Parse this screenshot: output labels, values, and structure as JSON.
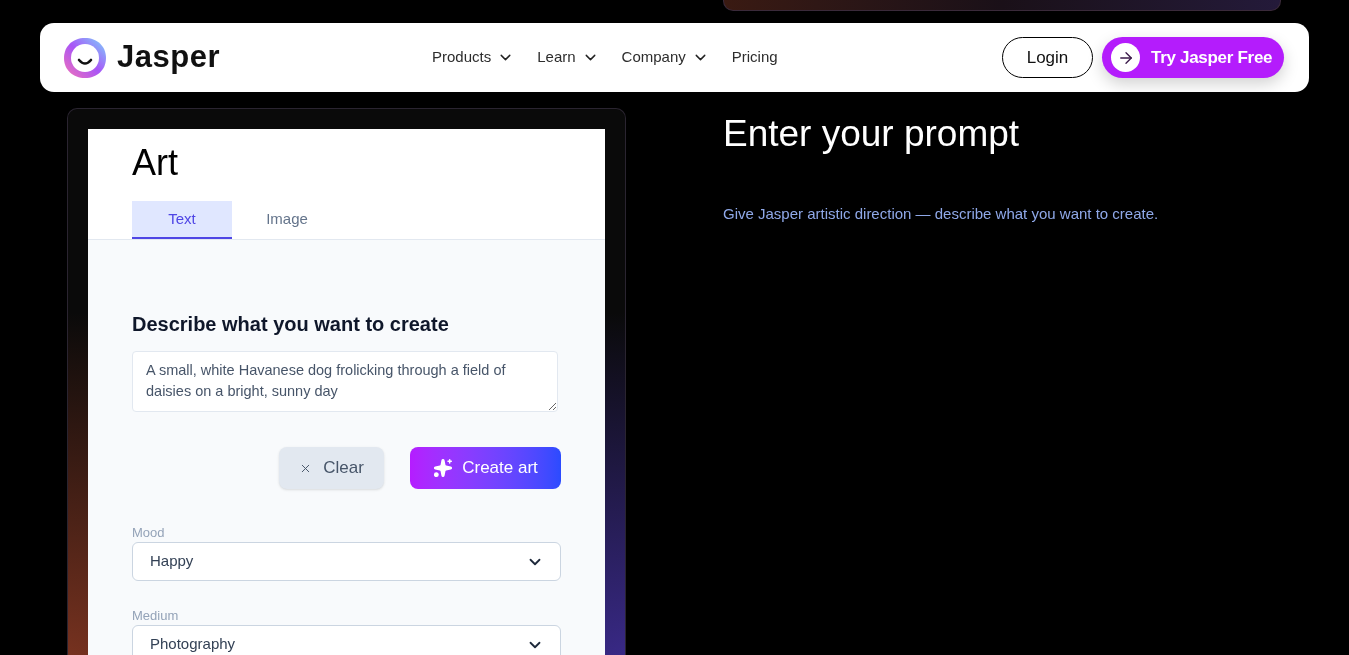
{
  "nav": {
    "brand": "Jasper",
    "links": [
      {
        "label": "Products",
        "dropdown": true
      },
      {
        "label": "Learn",
        "dropdown": true
      },
      {
        "label": "Company",
        "dropdown": true
      },
      {
        "label": "Pricing",
        "dropdown": false
      }
    ],
    "login": "Login",
    "cta": "Try Jasper Free"
  },
  "demo": {
    "title": "Art",
    "tabs": [
      {
        "label": "Text",
        "selected": true
      },
      {
        "label": "Image",
        "selected": false
      }
    ],
    "heading": "Describe what you want to create",
    "prompt": "A small, white Havanese dog frolicking through a field of daisies on a bright, sunny day",
    "clear": "Clear",
    "create": "Create art",
    "selects": [
      {
        "label": "Mood",
        "value": "Happy"
      },
      {
        "label": "Medium",
        "value": "Photography"
      }
    ]
  },
  "section": {
    "title": "Enter your prompt",
    "description": "Give Jasper artistic direction — describe what you want to create."
  }
}
